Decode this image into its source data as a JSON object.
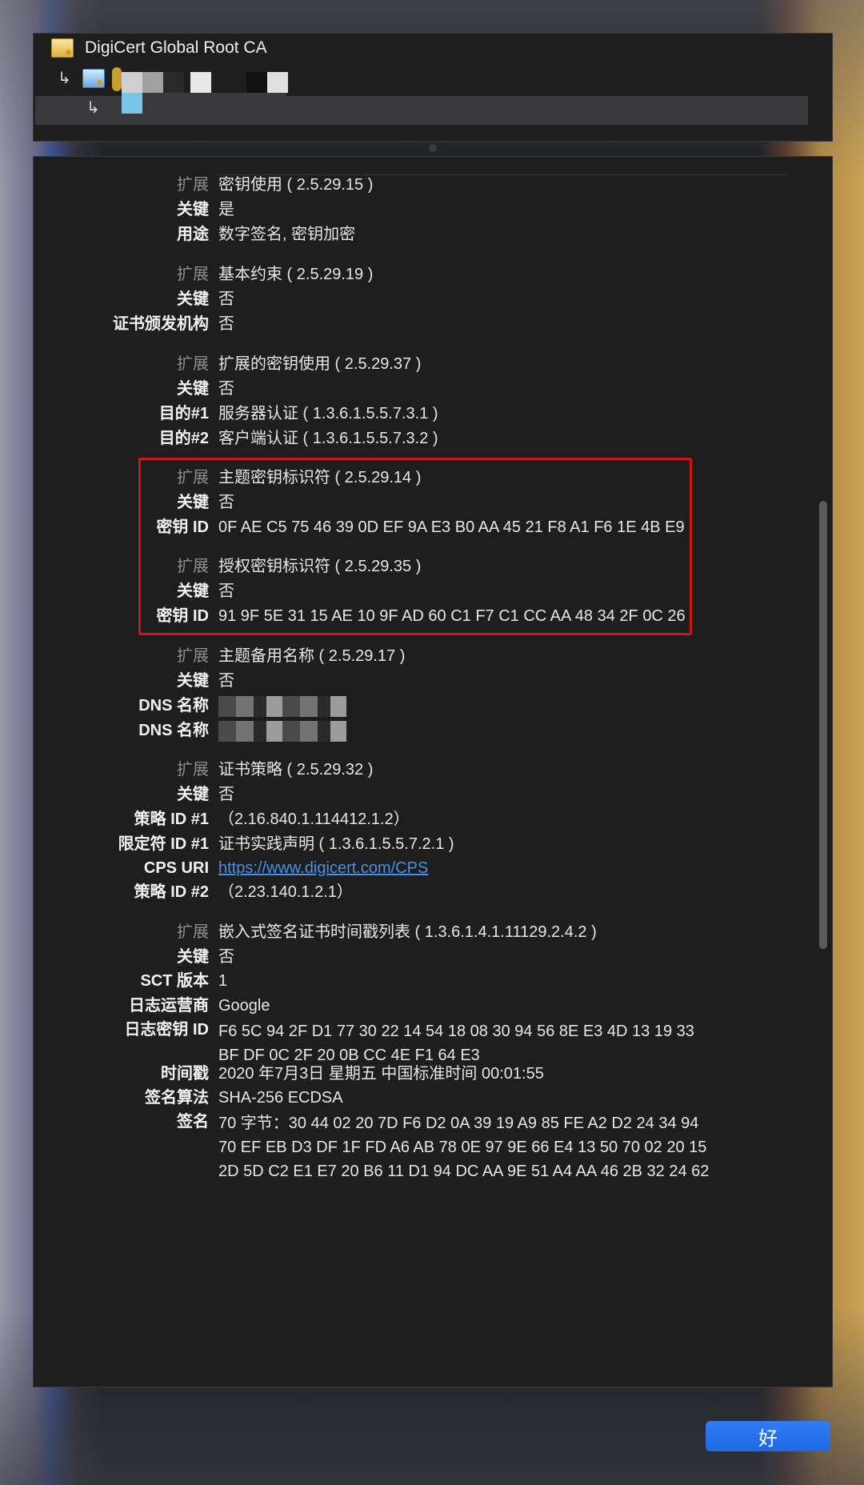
{
  "chain": {
    "root_name": "DigiCert Global Root CA",
    "intermediate_name": "C",
    "leaf_name": ""
  },
  "details": [
    {
      "label": "扩展",
      "value": "密钥使用 ( 2.5.29.15 )",
      "kind": "ext"
    },
    {
      "label": "关键",
      "value": "是"
    },
    {
      "label": "用途",
      "value": "数字签名, 密钥加密"
    },
    {
      "label": "扩展",
      "value": "基本约束 ( 2.5.29.19 )",
      "kind": "ext"
    },
    {
      "label": "关键",
      "value": "否"
    },
    {
      "label": "证书颁发机构",
      "value": "否"
    },
    {
      "label": "扩展",
      "value": "扩展的密钥使用 ( 2.5.29.37 )",
      "kind": "ext"
    },
    {
      "label": "关键",
      "value": "否"
    },
    {
      "label": "目的#1",
      "value": "服务器认证 ( 1.3.6.1.5.5.7.3.1 )"
    },
    {
      "label": "目的#2",
      "value": "客户端认证 ( 1.3.6.1.5.5.7.3.2 )"
    },
    {
      "label": "扩展",
      "value": "主题密钥标识符 ( 2.5.29.14 )",
      "kind": "ext"
    },
    {
      "label": "关键",
      "value": "否"
    },
    {
      "label": "密钥 ID",
      "value": "0F AE C5 75 46 39 0D EF 9A E3 B0 AA 45 21 F8 A1 F6 1E 4B E9"
    },
    {
      "label": "扩展",
      "value": "授权密钥标识符 ( 2.5.29.35 )",
      "kind": "ext"
    },
    {
      "label": "关键",
      "value": "否"
    },
    {
      "label": "密钥 ID",
      "value": "91 9F 5E 31 15 AE 10 9F AD 60 C1 F7 C1 CC AA 48 34 2F 0C 26"
    },
    {
      "label": "扩展",
      "value": "主题备用名称 ( 2.5.29.17 )",
      "kind": "ext"
    },
    {
      "label": "关键",
      "value": "否"
    },
    {
      "label": "DNS 名称",
      "value": "",
      "kind": "masked"
    },
    {
      "label": "DNS 名称",
      "value": "",
      "kind": "masked"
    },
    {
      "label": "扩展",
      "value": "证书策略 ( 2.5.29.32 )",
      "kind": "ext"
    },
    {
      "label": "关键",
      "value": "否"
    },
    {
      "label": "策略 ID #1",
      "value": "（2.16.840.1.114412.1.2）"
    },
    {
      "label": "限定符 ID #1",
      "value": "证书实践声明 ( 1.3.6.1.5.5.7.2.1 )"
    },
    {
      "label": "CPS URI",
      "value": "https://www.digicert.com/CPS",
      "kind": "link"
    },
    {
      "label": "策略 ID #2",
      "value": "（2.23.140.1.2.1）"
    },
    {
      "label": "扩展",
      "value": "嵌入式签名证书时间戳列表 ( 1.3.6.1.4.1.11129.2.4.2 )",
      "kind": "ext"
    },
    {
      "label": "关键",
      "value": "否"
    },
    {
      "label": "SCT 版本",
      "value": "1"
    },
    {
      "label": "日志运营商",
      "value": "Google"
    },
    {
      "label": "日志密钥 ID",
      "value": "F6 5C 94 2F D1 77 30 22 14 54 18 08 30 94 56 8E E3 4D 13 19 33",
      "value2": "BF DF 0C 2F 20 0B CC 4E F1 64 E3"
    },
    {
      "label": "时间戳",
      "value": "2020 年7月3日 星期五 中国标准时间 00:01:55"
    },
    {
      "label": "签名算法",
      "value": "SHA-256 ECDSA"
    },
    {
      "label": "签名",
      "value": "70 字节：30 44 02 20 7D F6 D2 0A 39 19 A9 85 FE A2 D2 24 34 94",
      "value2": "70 EF EB D3 DF 1F FD A6 AB 78 0E 97 9E 66 E4 13 50 70 02 20 15",
      "value3": "2D 5D C2 E1 E7 20 B6 11 D1 94 DC AA 9E 51 A4 AA 46 2B 32 24 62"
    }
  ],
  "buttons": {
    "ok_label": "好"
  },
  "colors": {
    "highlight": "#d0121b",
    "link": "#4a90e2",
    "button": "#2f7cf6"
  }
}
